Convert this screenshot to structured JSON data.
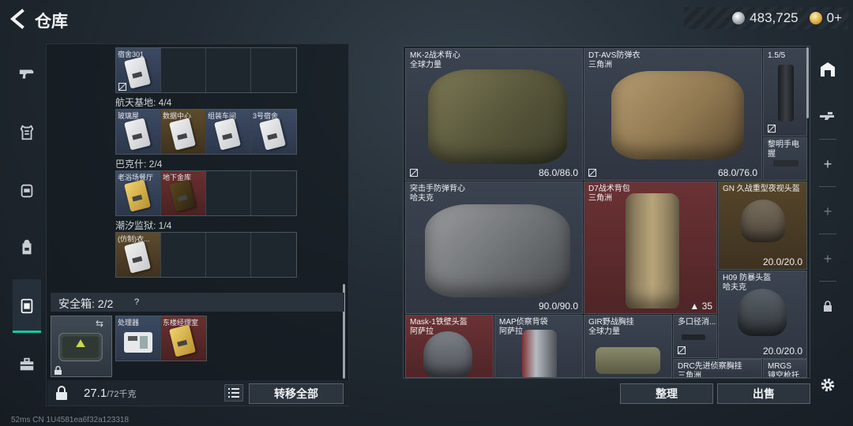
{
  "header": {
    "title": "仓库",
    "currency_value": "483,725",
    "premium_value": "0+"
  },
  "left_panel": {
    "sections": [
      {
        "label": "",
        "cells": [
          {
            "label": "宿舍301",
            "tone": "blue",
            "card": "white",
            "nolink": true
          },
          {
            "label": "",
            "tone": "empty"
          },
          {
            "label": "",
            "tone": "empty"
          },
          {
            "label": "",
            "tone": "empty"
          }
        ]
      },
      {
        "label": "航天基地: 4/4",
        "cells": [
          {
            "label": "玻璃屋",
            "tone": "blue",
            "card": "white"
          },
          {
            "label": "数据中心",
            "tone": "gold",
            "card": "white"
          },
          {
            "label": "组装车间",
            "tone": "blue",
            "card": "white"
          },
          {
            "label": "3号宿舍",
            "tone": "blue",
            "card": "white"
          }
        ]
      },
      {
        "label": "巴克什: 2/4",
        "cells": [
          {
            "label": "老浴场餐厅",
            "tone": "blue",
            "card": "yellow"
          },
          {
            "label": "地下金库",
            "tone": "red",
            "card": "dark"
          },
          {
            "label": "",
            "tone": "empty"
          },
          {
            "label": "",
            "tone": "empty"
          }
        ]
      },
      {
        "label": "潮汐监狱: 1/4",
        "cells": [
          {
            "label": "(仿制)衣...",
            "tone": "gold",
            "card": "white"
          },
          {
            "label": "",
            "tone": "empty"
          },
          {
            "label": "",
            "tone": "empty"
          },
          {
            "label": "",
            "tone": "empty"
          }
        ]
      }
    ],
    "safe": {
      "title": "安全箱: 2/2",
      "help": "?",
      "swap": "⇆",
      "cells": [
        {
          "label": "处理器",
          "tone": "blue",
          "card": "white"
        },
        {
          "label": "东楼经理室",
          "tone": "red",
          "card": "yellow"
        }
      ]
    },
    "weight_value": "27.1",
    "weight_max": "/72千克",
    "transfer_label": "转移全部"
  },
  "warehouse": {
    "items": [
      {
        "name": "MK-2战术背心",
        "sub": "全球力量",
        "durability": "86.0/86.0",
        "tone": "gray"
      },
      {
        "name": "DT-AVS防弹衣",
        "sub": "三角洲",
        "durability": "68.0/76.0",
        "tone": "gray"
      },
      {
        "name": "1.5/5",
        "sub": "",
        "durability": "",
        "tone": "gray"
      },
      {
        "name": "黎明手电握",
        "sub": "",
        "durability": "",
        "tone": "gray"
      },
      {
        "name": "突击手防弹背心",
        "sub": "哈夫克",
        "durability": "90.0/90.0",
        "tone": "gray"
      },
      {
        "name": "D7战术背包",
        "sub": "三角洲",
        "durability": "35",
        "tone": "red"
      },
      {
        "name": "GN 久战重型夜视头盔",
        "sub": "",
        "durability": "20.0/20.0",
        "tone": "gold"
      },
      {
        "name": "H09 防暴头盔",
        "sub": "哈夫克",
        "durability": "20.0/20.0",
        "tone": "gray"
      },
      {
        "name": "Mask-1铁壁头盔",
        "sub": "阿萨拉",
        "durability": "",
        "tone": "red"
      },
      {
        "name": "MAP侦察背袋",
        "sub": "阿萨拉",
        "durability": "",
        "tone": "gray"
      },
      {
        "name": "GIR野战胸挂",
        "sub": "全球力量",
        "durability": "",
        "tone": "gray"
      },
      {
        "name": "多口径消...",
        "sub": "",
        "durability": "",
        "tone": "gray"
      },
      {
        "name": "DRC先进侦察胸挂",
        "sub": "三角洲",
        "durability": "",
        "tone": "gray"
      },
      {
        "name": "MRGS",
        "sub": "镜空枪托",
        "durability": "",
        "tone": "gray"
      }
    ],
    "tidy_label": "整理",
    "sell_label": "出售"
  },
  "nav_icons": [
    "pistol-icon",
    "armor-icon",
    "helmet-icon",
    "backpack-icon",
    "safe-box-icon",
    "toolbox-icon"
  ],
  "tools": [
    "warehouse-icon",
    "rifle-icon",
    "plus-icon",
    "plus-icon",
    "plus-icon",
    "lock-icon",
    "settings-icon"
  ],
  "status": "52ms   CN 1U4581ea6f32a123318",
  "colors": {
    "accent": "#18c7a2",
    "red_item": "#6b3234",
    "gold_item": "#55452a"
  }
}
